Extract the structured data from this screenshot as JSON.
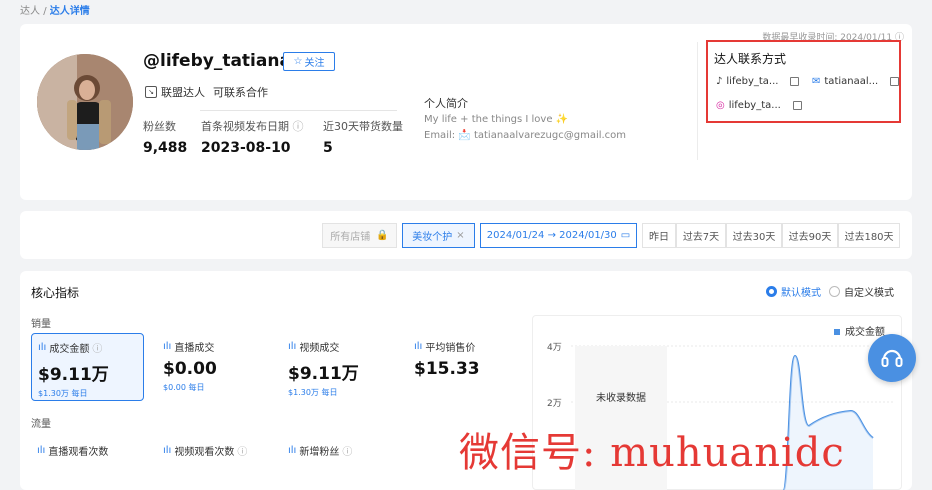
{
  "breadcrumb": {
    "parent": "达人",
    "sep": "/",
    "current": "达人详情"
  },
  "profile": {
    "handle": "@lifeby_tatiana",
    "follow_label": "关注",
    "tag": "联盟达人",
    "tag_sub": "可联系合作",
    "stats": [
      {
        "label": "粉丝数",
        "value": "9,488"
      },
      {
        "label": "首条视频发布日期",
        "value": "2023-08-10"
      },
      {
        "label": "近30天带货数量",
        "value": "5"
      }
    ],
    "bio_title": "个人简介",
    "bio_text": "My life + the things I love ✨",
    "bio_email_label": "Email:",
    "bio_email": "tatianaalvarezugc@gmail.com",
    "updated": "数据最早收录时间: 2024/01/11",
    "contact": {
      "title": "达人联系方式",
      "tiktok": "lifeby_ta...",
      "email": "tatianaal...",
      "instagram": "lifeby_ta..."
    }
  },
  "filter": {
    "store": "所有店铺",
    "category": "美妆个护",
    "date_range": "2024/01/24 → 2024/01/30",
    "quick": [
      "昨日",
      "过去7天",
      "过去30天",
      "过去90天",
      "过去180天"
    ]
  },
  "metrics": {
    "title": "核心指标",
    "mode_default": "默认模式",
    "mode_custom": "自定义模式",
    "sales_label": "销量",
    "traffic_label": "流量",
    "kpis": [
      {
        "label": "成交金额",
        "value": "$9.11万",
        "sub": "$1.30万 每日"
      },
      {
        "label": "直播成交",
        "value": "$0.00",
        "sub": "$0.00 每日"
      },
      {
        "label": "视频成交",
        "value": "$9.11万",
        "sub": "$1.30万 每日"
      },
      {
        "label": "平均销售价",
        "value": "$15.33",
        "sub": ""
      }
    ],
    "traffic": [
      "直播观看次数",
      "视频观看次数",
      "新增粉丝"
    ]
  },
  "chart": {
    "legend": "成交金额",
    "y_ticks": [
      "4万",
      "2万"
    ],
    "no_data": "未收录数据"
  },
  "watermark": "微信号: muhuanidc",
  "colors": {
    "accent": "#2b7de9",
    "highlight": "#e53935"
  }
}
